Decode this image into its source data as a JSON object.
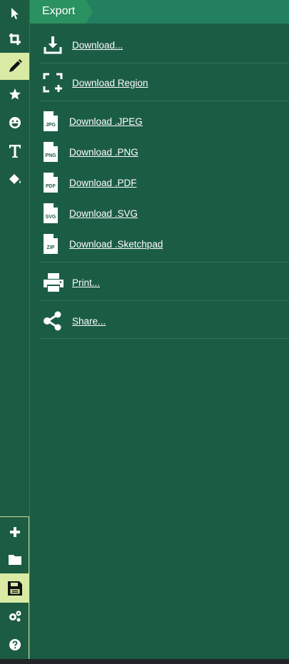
{
  "toolbar": {
    "tools": [
      {
        "name": "select-tool",
        "icon": "arrow-cursor-icon"
      },
      {
        "name": "crop-tool",
        "icon": "crop-icon"
      },
      {
        "name": "pencil-tool",
        "icon": "pencil-icon",
        "active": true
      },
      {
        "name": "stamp-tool",
        "icon": "star-icon"
      },
      {
        "name": "emoji-tool",
        "icon": "smiley-icon"
      },
      {
        "name": "text-tool",
        "icon": "text-t-icon"
      },
      {
        "name": "fill-tool",
        "icon": "paint-bucket-icon"
      }
    ],
    "bottom_tools": [
      {
        "name": "new-button",
        "icon": "plus-icon"
      },
      {
        "name": "open-button",
        "icon": "folder-icon"
      },
      {
        "name": "save-button",
        "icon": "floppy-disk-icon",
        "active": true
      },
      {
        "name": "settings-button",
        "icon": "gears-icon"
      },
      {
        "name": "help-button",
        "icon": "question-circle-icon"
      }
    ]
  },
  "panel": {
    "title": "Export",
    "items": {
      "download": {
        "label": "Download...",
        "icon": "download-arrow-icon"
      },
      "download_region": {
        "label": "Download Region",
        "icon": "region-select-icon"
      },
      "jpeg": {
        "label": "Download .JPEG",
        "icon": "file-jpg-icon",
        "badge": "JPG"
      },
      "png": {
        "label": "Download .PNG",
        "icon": "file-png-icon",
        "badge": "PNG"
      },
      "pdf": {
        "label": "Download .PDF",
        "icon": "file-pdf-icon",
        "badge": "PDF"
      },
      "svg": {
        "label": "Download .SVG",
        "icon": "file-svg-icon",
        "badge": "SVG"
      },
      "sketchpad": {
        "label": "Download .Sketchpad",
        "icon": "file-zip-icon",
        "badge": "ZIP"
      },
      "print": {
        "label": "Print...",
        "icon": "printer-icon"
      },
      "share": {
        "label": "Share...",
        "icon": "share-icon"
      }
    }
  },
  "colors": {
    "background": "#1b5c45",
    "header": "#228060",
    "header_tab": "#2a9160",
    "active_tool": "#d9eaa4",
    "text": "#ffffff"
  }
}
